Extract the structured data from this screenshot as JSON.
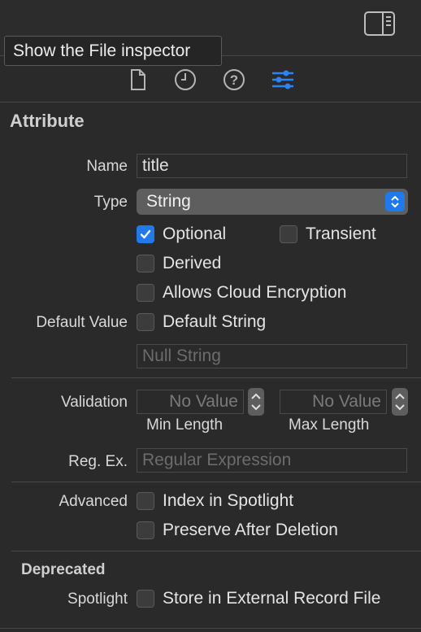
{
  "tooltip": {
    "text": "Show the File inspector"
  },
  "tabs": [
    {
      "icon": "file-icon"
    },
    {
      "icon": "history-clock-icon"
    },
    {
      "icon": "help-icon"
    },
    {
      "icon": "attributes-sliders-icon",
      "selected": true
    }
  ],
  "section": {
    "title": "Attribute"
  },
  "name": {
    "label": "Name",
    "value": "title"
  },
  "type": {
    "label": "Type",
    "value": "String"
  },
  "options": {
    "optional": {
      "label": "Optional",
      "checked": true
    },
    "transient": {
      "label": "Transient",
      "checked": false
    },
    "derived": {
      "label": "Derived",
      "checked": false
    },
    "cloud_encryption": {
      "label": "Allows Cloud Encryption",
      "checked": false
    }
  },
  "default_value": {
    "label": "Default Value",
    "checkbox_label": "Default String",
    "checked": false,
    "placeholder": "Null String"
  },
  "validation": {
    "label": "Validation",
    "min_placeholder": "No Value",
    "max_placeholder": "No Value",
    "min_label": "Min Length",
    "max_label": "Max Length"
  },
  "regex": {
    "label": "Reg. Ex.",
    "placeholder": "Regular Expression"
  },
  "advanced": {
    "label": "Advanced",
    "index_spotlight": "Index in Spotlight",
    "preserve_deletion": "Preserve After Deletion"
  },
  "deprecated": {
    "title": "Deprecated",
    "spotlight_label": "Spotlight",
    "external_record": "Store in External Record File"
  },
  "colors": {
    "accent": "#1f7aee",
    "background": "#2a2a2a"
  }
}
